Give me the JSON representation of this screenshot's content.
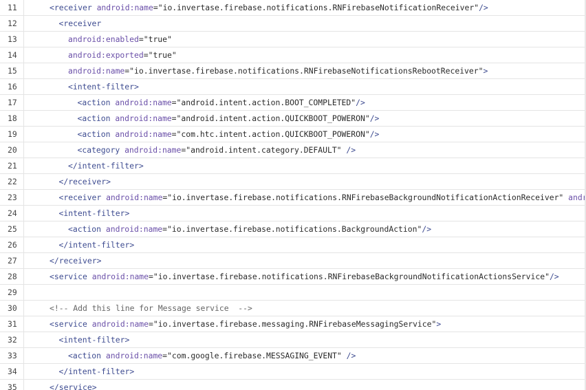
{
  "lines": [
    {
      "n": "11",
      "indent": 0,
      "parts": [
        [
          "t",
          "<receiver "
        ],
        [
          "a",
          "android:name"
        ],
        [
          "p",
          "="
        ],
        [
          "v",
          "\"io.invertase.firebase.notifications.RNFirebaseNotificationReceiver\""
        ],
        [
          "t",
          "/>"
        ]
      ]
    },
    {
      "n": "12",
      "indent": 1,
      "parts": [
        [
          "t",
          "<receiver"
        ]
      ]
    },
    {
      "n": "13",
      "indent": 2,
      "parts": [
        [
          "a",
          "android:enabled"
        ],
        [
          "p",
          "="
        ],
        [
          "v",
          "\"true\""
        ]
      ]
    },
    {
      "n": "14",
      "indent": 2,
      "parts": [
        [
          "a",
          "android:exported"
        ],
        [
          "p",
          "="
        ],
        [
          "v",
          "\"true\""
        ]
      ]
    },
    {
      "n": "15",
      "indent": 2,
      "parts": [
        [
          "a",
          "android:name"
        ],
        [
          "p",
          "="
        ],
        [
          "v",
          "\"io.invertase.firebase.notifications.RNFirebaseNotificationsRebootReceiver\""
        ],
        [
          "t",
          ">"
        ]
      ]
    },
    {
      "n": "16",
      "indent": 2,
      "parts": [
        [
          "t",
          "<intent-filter>"
        ]
      ]
    },
    {
      "n": "17",
      "indent": 3,
      "parts": [
        [
          "t",
          "<action "
        ],
        [
          "a",
          "android:name"
        ],
        [
          "p",
          "="
        ],
        [
          "v",
          "\"android.intent.action.BOOT_COMPLETED\""
        ],
        [
          "t",
          "/>"
        ]
      ]
    },
    {
      "n": "18",
      "indent": 3,
      "parts": [
        [
          "t",
          "<action "
        ],
        [
          "a",
          "android:name"
        ],
        [
          "p",
          "="
        ],
        [
          "v",
          "\"android.intent.action.QUICKBOOT_POWERON\""
        ],
        [
          "t",
          "/>"
        ]
      ]
    },
    {
      "n": "19",
      "indent": 3,
      "parts": [
        [
          "t",
          "<action "
        ],
        [
          "a",
          "android:name"
        ],
        [
          "p",
          "="
        ],
        [
          "v",
          "\"com.htc.intent.action.QUICKBOOT_POWERON\""
        ],
        [
          "t",
          "/>"
        ]
      ]
    },
    {
      "n": "20",
      "indent": 3,
      "parts": [
        [
          "t",
          "<category "
        ],
        [
          "a",
          "android:name"
        ],
        [
          "p",
          "="
        ],
        [
          "v",
          "\"android.intent.category.DEFAULT\""
        ],
        [
          "t",
          " />"
        ]
      ]
    },
    {
      "n": "21",
      "indent": 2,
      "parts": [
        [
          "t",
          "</intent-filter>"
        ]
      ]
    },
    {
      "n": "22",
      "indent": 1,
      "parts": [
        [
          "t",
          "</receiver>"
        ]
      ]
    },
    {
      "n": "23",
      "indent": 1,
      "parts": [
        [
          "t",
          "<receiver "
        ],
        [
          "a",
          "android:name"
        ],
        [
          "p",
          "="
        ],
        [
          "v",
          "\"io.invertase.firebase.notifications.RNFirebaseBackgroundNotificationActionReceiver\""
        ],
        [
          "p",
          " "
        ],
        [
          "a",
          "android:"
        ]
      ]
    },
    {
      "n": "24",
      "indent": 1,
      "parts": [
        [
          "t",
          "<intent-filter>"
        ]
      ]
    },
    {
      "n": "25",
      "indent": 2,
      "parts": [
        [
          "t",
          "<action "
        ],
        [
          "a",
          "android:name"
        ],
        [
          "p",
          "="
        ],
        [
          "v",
          "\"io.invertase.firebase.notifications.BackgroundAction\""
        ],
        [
          "t",
          "/>"
        ]
      ]
    },
    {
      "n": "26",
      "indent": 1,
      "parts": [
        [
          "t",
          "</intent-filter>"
        ]
      ]
    },
    {
      "n": "27",
      "indent": 0,
      "parts": [
        [
          "t",
          "</receiver>"
        ]
      ]
    },
    {
      "n": "28",
      "indent": 0,
      "parts": [
        [
          "t",
          "<service "
        ],
        [
          "a",
          "android:name"
        ],
        [
          "p",
          "="
        ],
        [
          "v",
          "\"io.invertase.firebase.notifications.RNFirebaseBackgroundNotificationActionsService\""
        ],
        [
          "t",
          "/>"
        ]
      ]
    },
    {
      "n": "29",
      "indent": 0,
      "parts": []
    },
    {
      "n": "30",
      "indent": 0,
      "parts": [
        [
          "c",
          "<!-- Add this line for Message service  -->"
        ]
      ]
    },
    {
      "n": "31",
      "indent": 0,
      "parts": [
        [
          "t",
          "<service "
        ],
        [
          "a",
          "android:name"
        ],
        [
          "p",
          "="
        ],
        [
          "v",
          "\"io.invertase.firebase.messaging.RNFirebaseMessagingService\""
        ],
        [
          "t",
          ">"
        ]
      ]
    },
    {
      "n": "32",
      "indent": 1,
      "parts": [
        [
          "t",
          "<intent-filter>"
        ]
      ]
    },
    {
      "n": "33",
      "indent": 2,
      "parts": [
        [
          "t",
          "<action "
        ],
        [
          "a",
          "android:name"
        ],
        [
          "p",
          "="
        ],
        [
          "v",
          "\"com.google.firebase.MESSAGING_EVENT\""
        ],
        [
          "t",
          " />"
        ]
      ]
    },
    {
      "n": "34",
      "indent": 1,
      "parts": [
        [
          "t",
          "</intent-filter>"
        ]
      ]
    },
    {
      "n": "35",
      "indent": 0,
      "parts": [
        [
          "t",
          "</service>"
        ]
      ]
    }
  ]
}
